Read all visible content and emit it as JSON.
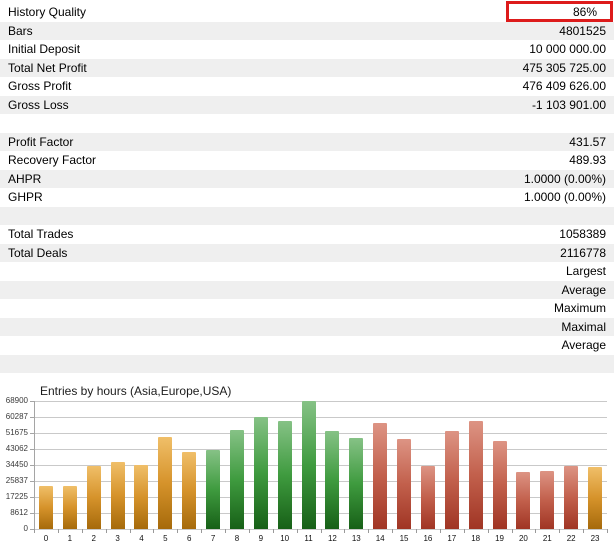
{
  "report": {
    "stripe_color": "#efefef",
    "highlight_color": "#dd1b1b",
    "rows": [
      {
        "label": "History Quality",
        "value": "86%",
        "highlighted": true
      },
      {
        "label": "Bars",
        "value": "4801525"
      },
      {
        "label": "Initial Deposit",
        "value": "10 000 000.00"
      },
      {
        "label": "Total Net Profit",
        "value": "475 305 725.00"
      },
      {
        "label": "Gross Profit",
        "value": "476 409 626.00"
      },
      {
        "label": "Gross Loss",
        "value": "-1 103 901.00"
      },
      {
        "label": "",
        "value": ""
      },
      {
        "label": "Profit Factor",
        "value": "431.57"
      },
      {
        "label": "Recovery Factor",
        "value": "489.93"
      },
      {
        "label": "AHPR",
        "value": "1.0000 (0.00%)"
      },
      {
        "label": "GHPR",
        "value": "1.0000 (0.00%)"
      },
      {
        "label": "",
        "value": ""
      },
      {
        "label": "Total Trades",
        "value": "1058389"
      },
      {
        "label": "Total Deals",
        "value": "2116778"
      },
      {
        "label": "",
        "value": "Largest"
      },
      {
        "label": "",
        "value": "Average"
      },
      {
        "label": "",
        "value": "Maximum"
      },
      {
        "label": "",
        "value": "Maximal"
      },
      {
        "label": "",
        "value": "Average"
      },
      {
        "label": "",
        "value": ""
      }
    ]
  },
  "chart_data": {
    "type": "bar",
    "title": "Entries by hours (Asia,Europe,USA)",
    "xlabel": "",
    "ylabel": "",
    "ylim": [
      0,
      68900
    ],
    "grid": true,
    "y_ticks": [
      0,
      8612,
      17225,
      25837,
      34450,
      43062,
      51675,
      60287,
      68900
    ],
    "categories": [
      "0",
      "1",
      "2",
      "3",
      "4",
      "5",
      "6",
      "7",
      "8",
      "9",
      "10",
      "11",
      "12",
      "13",
      "14",
      "15",
      "16",
      "17",
      "18",
      "19",
      "20",
      "21",
      "22",
      "23"
    ],
    "values": [
      23200,
      23200,
      34100,
      36100,
      34500,
      49600,
      41400,
      42700,
      53100,
      60500,
      58300,
      68900,
      52800,
      49100,
      57300,
      48700,
      33800,
      52500,
      57900,
      47100,
      30600,
      31300,
      33800,
      33400
    ],
    "bar_sessions": [
      "asia",
      "asia",
      "asia",
      "asia",
      "asia",
      "asia",
      "asia",
      "europe",
      "europe",
      "europe",
      "europe",
      "europe",
      "europe",
      "europe",
      "usa",
      "usa",
      "usa",
      "usa",
      "usa",
      "usa",
      "usa",
      "usa",
      "usa",
      "asia"
    ],
    "session_colors": {
      "asia": {
        "top": "#f0bf69",
        "mid": "#d6932b",
        "bottom": "#a66a0b"
      },
      "europe": {
        "top": "#86c286",
        "mid": "#3f9b3f",
        "bottom": "#176017"
      },
      "usa": {
        "top": "#dd9484",
        "mid": "#c2604c",
        "bottom": "#a03524"
      }
    }
  }
}
